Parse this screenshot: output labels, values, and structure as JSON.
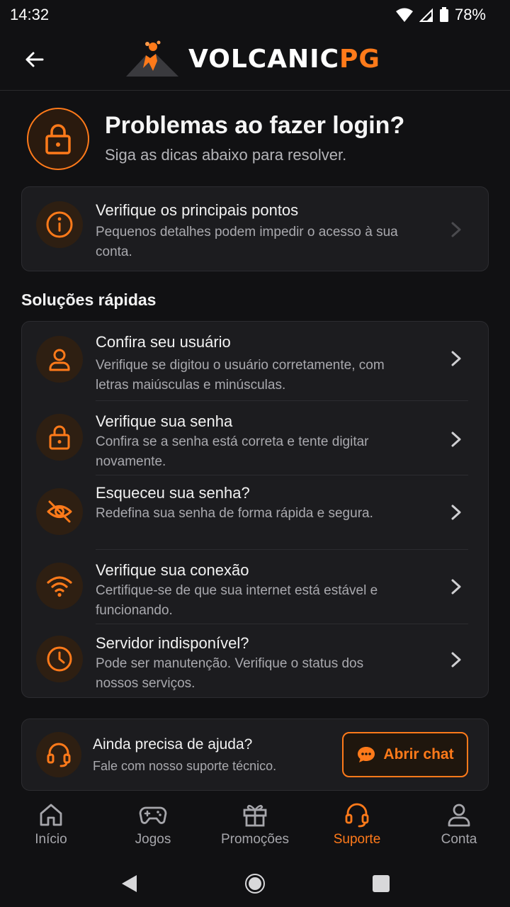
{
  "status_bar": {
    "time": "14:32",
    "battery": "78%"
  },
  "header": {
    "logo_main": "VOLCANIC",
    "logo_accent": "PG",
    "back_icon": "arrow-left-icon"
  },
  "hero": {
    "title": "Problemas ao fazer login?",
    "subtitle": "Siga as dicas abaixo para resolver.",
    "icon": "lock-icon"
  },
  "check_card": {
    "title": "Verifique os principais pontos",
    "description": "Pequenos detalhes podem impedir o acesso à sua conta.",
    "icon": "info-icon"
  },
  "quick_solutions": {
    "title": "Soluções rápidas",
    "items": [
      {
        "title": "Confira seu usuário",
        "description": "Verifique se digitou o usuário corretamente, com letras maiúsculas e minúsculas.",
        "icon": "user-icon"
      },
      {
        "title": "Verifique sua senha",
        "description": "Confira se a senha está correta e tente digitar novamente.",
        "icon": "lock-icon"
      },
      {
        "title": "Esqueceu sua senha?",
        "description": "Redefina sua senha de forma rápida e segura.",
        "icon": "eye-off-icon"
      },
      {
        "title": "Verifique sua conexão",
        "description": "Certifique-se de que sua internet está estável e funcionando.",
        "icon": "wifi-icon"
      },
      {
        "title": "Servidor indisponível?",
        "description": "Pode ser manutenção. Verifique o status dos nossos serviços.",
        "icon": "clock-icon"
      }
    ]
  },
  "help": {
    "title": "Ainda precisa de ajuda?",
    "subtitle": "Fale com nosso suporte técnico.",
    "button_label": "Abrir chat",
    "icon": "headset-icon"
  },
  "bottom_nav": {
    "items": [
      {
        "label": "Início",
        "icon": "home-icon"
      },
      {
        "label": "Jogos",
        "icon": "gamepad-icon"
      },
      {
        "label": "Promoções",
        "icon": "gift-icon"
      },
      {
        "label": "Suporte",
        "icon": "headset-icon",
        "active": true
      },
      {
        "label": "Conta",
        "icon": "user-icon"
      }
    ]
  },
  "colors": {
    "accent": "#ff7a1a",
    "background": "#111113",
    "card": "#1c1c1f"
  }
}
